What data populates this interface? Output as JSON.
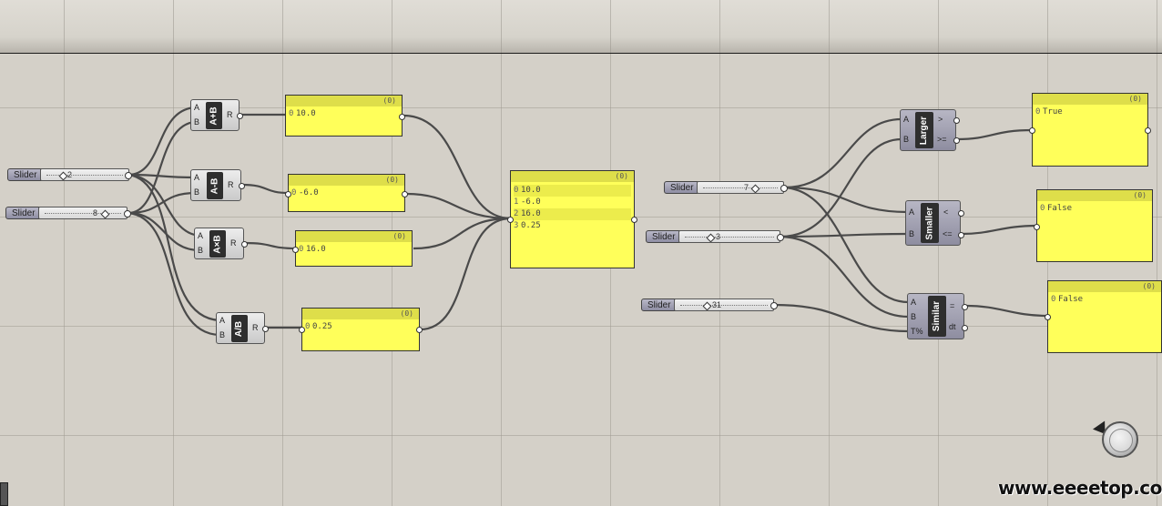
{
  "toolbar": {},
  "sliders": [
    {
      "id": "s1",
      "label": "Slider",
      "value": "2",
      "knob": 0.2
    },
    {
      "id": "s2",
      "label": "Slider",
      "value": "8",
      "knob": 0.72
    },
    {
      "id": "s3",
      "label": "Slider",
      "value": "7",
      "knob": 0.62
    },
    {
      "id": "s4",
      "label": "Slider",
      "value": "3",
      "knob": 0.28
    },
    {
      "id": "s5",
      "label": "Slider",
      "value": "31",
      "knob": 0.36
    }
  ],
  "math_components": [
    {
      "id": "add",
      "inputs": [
        "A",
        "B"
      ],
      "nickname": "A+B",
      "output": "R"
    },
    {
      "id": "sub",
      "inputs": [
        "A",
        "B"
      ],
      "nickname": "A-B",
      "output": "R"
    },
    {
      "id": "mul",
      "inputs": [
        "A",
        "B"
      ],
      "nickname": "A×B",
      "output": "R"
    },
    {
      "id": "div",
      "inputs": [
        "A",
        "B"
      ],
      "nickname": "A/B",
      "output": "R"
    }
  ],
  "compare_components": [
    {
      "id": "larger",
      "inputs": [
        "A",
        "B"
      ],
      "nickname": "Larger",
      "outputs": [
        ">",
        ">="
      ]
    },
    {
      "id": "smaller",
      "inputs": [
        "A",
        "B"
      ],
      "nickname": "Smaller",
      "outputs": [
        "<",
        "<="
      ]
    },
    {
      "id": "similar",
      "inputs": [
        "A",
        "B",
        "T%"
      ],
      "nickname": "Similar",
      "outputs": [
        "=",
        "dt"
      ]
    }
  ],
  "panels": {
    "add": {
      "count": "(0)",
      "rows": [
        {
          "index": "0",
          "value": "10.0"
        }
      ]
    },
    "sub": {
      "count": "(0)",
      "rows": [
        {
          "index": "0",
          "value": "-6.0"
        }
      ]
    },
    "mul": {
      "count": "(0)",
      "rows": [
        {
          "index": "0",
          "value": "16.0"
        }
      ]
    },
    "div": {
      "count": "(0)",
      "rows": [
        {
          "index": "0",
          "value": "0.25"
        }
      ]
    },
    "merged": {
      "count": "(0)",
      "rows": [
        {
          "index": "0",
          "value": "10.0"
        },
        {
          "index": "1",
          "value": "-6.0"
        },
        {
          "index": "2",
          "value": "16.0"
        },
        {
          "index": "3",
          "value": "0.25"
        }
      ]
    },
    "larger": {
      "count": "(0)",
      "rows": [
        {
          "index": "0",
          "value": "True"
        }
      ]
    },
    "smaller": {
      "count": "(0)",
      "rows": [
        {
          "index": "0",
          "value": "False"
        }
      ]
    },
    "similar": {
      "count": "(0)",
      "rows": [
        {
          "index": "0",
          "value": "False"
        }
      ]
    }
  },
  "watermark": "www.eeeetop.com",
  "colors": {
    "canvas": "#d4d0c8",
    "panel": "#ffff5a",
    "wire": "#4a4a4a"
  }
}
